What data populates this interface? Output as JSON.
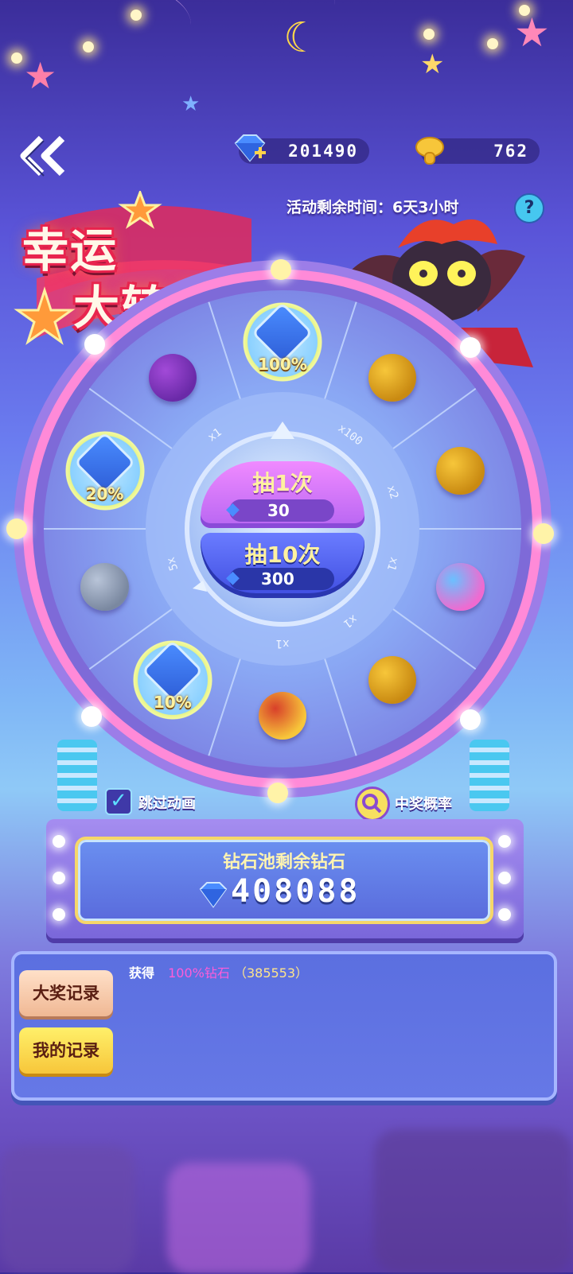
{
  "header": {
    "diamonds": "201490",
    "mushrooms": "762",
    "countdown": "活动剩余时间：6天3小时",
    "help_symbol": "?"
  },
  "title": {
    "line1": "幸运",
    "line2": "大转盘"
  },
  "wheel": {
    "segments": [
      {
        "item": "diamond-pile-icon",
        "badge": "100%"
      },
      {
        "item": "gold-coins-icon",
        "count": "x100"
      },
      {
        "item": "golden-mushroom-icon",
        "count": "x2"
      },
      {
        "item": "rainbow-portal-icon",
        "count": "x1"
      },
      {
        "item": "golden-mystery-egg-icon",
        "count": "x1"
      },
      {
        "item": "treasure-chest-icon",
        "count": "x1"
      },
      {
        "item": "diamond-pile-icon",
        "badge": "10%"
      },
      {
        "item": "stone-mushroom-icon",
        "count": "5x"
      },
      {
        "item": "diamond-pile-icon",
        "badge": "20%"
      },
      {
        "item": "mystery-orb-icon",
        "count": "x1"
      }
    ],
    "draw_once": {
      "label": "抽1次",
      "cost": "30"
    },
    "draw_ten": {
      "label": "抽10次",
      "cost": "300"
    }
  },
  "options": {
    "skip_animation": "跳过动画",
    "win_odds": "中奖概率",
    "skip_checked": true
  },
  "pool": {
    "label": "钻石池剩余钻石",
    "value": "408088"
  },
  "records": {
    "grand_prize_tab": "大奖记录",
    "my_records_tab": "我的记录",
    "entry_prefix": "获得",
    "entry_item": "100%钻石",
    "entry_amount": "（385553）"
  },
  "colors": {
    "diamond": "#4a8cff",
    "gold": "#f7c63a",
    "pink_text": "#ff5cd9",
    "wheel_rim": "#ff8ad8"
  }
}
